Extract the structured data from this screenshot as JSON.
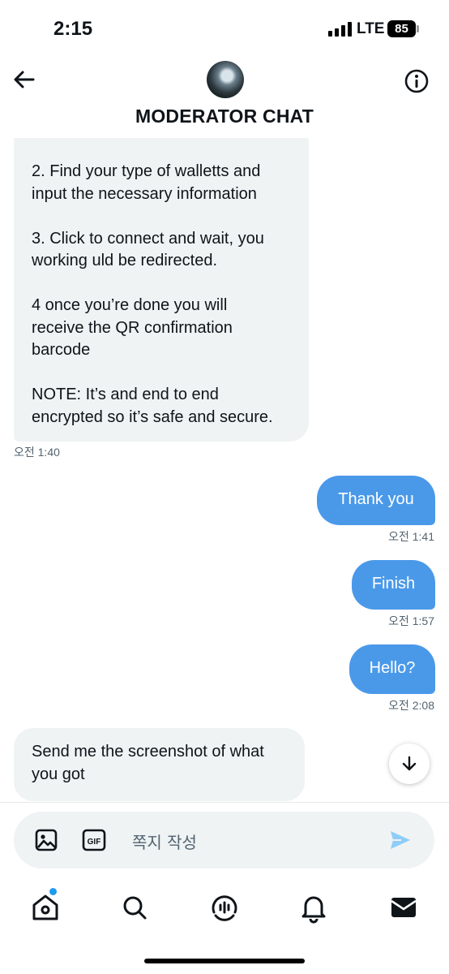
{
  "status": {
    "time": "2:15",
    "network": "LTE",
    "battery": "85"
  },
  "header": {
    "title": "MODERATOR CHAT"
  },
  "messages": [
    {
      "direction": "incoming",
      "text": "2. Find your type of walletts and\ninput the necessary information\n\n3. Click to connect and wait, you\nworking uld be redirected.\n\n4 once you’re done you will\nreceive the QR confirmation\nbarcode\n\nNOTE: It’s and end to end\nencrypted so it’s safe and secure.",
      "time": "오전 1:40"
    },
    {
      "direction": "outgoing",
      "text": "Thank you",
      "time": "오전 1:41"
    },
    {
      "direction": "outgoing",
      "text": "Finish",
      "time": "오전 1:57"
    },
    {
      "direction": "outgoing",
      "text": "Hello?",
      "time": "오전 2:08"
    },
    {
      "direction": "incoming",
      "text": "Send me the screenshot of what\nyou got",
      "time": ""
    }
  ],
  "composer": {
    "placeholder": "쪽지 작성",
    "gif_label": "GIF"
  },
  "icons": {
    "back": "arrow-left-icon",
    "info": "info-icon",
    "scroll_down": "arrow-down-icon",
    "image": "image-icon",
    "gif": "gif-icon",
    "send": "send-icon",
    "home": "home-icon",
    "search": "search-icon",
    "spaces": "spaces-icon",
    "notifications": "bell-icon",
    "messages": "mail-icon"
  },
  "colors": {
    "outgoing_bubble": "#4a99e9",
    "incoming_bubble": "#eff3f4",
    "accent": "#1d9bf0",
    "timestamp": "#536471"
  }
}
